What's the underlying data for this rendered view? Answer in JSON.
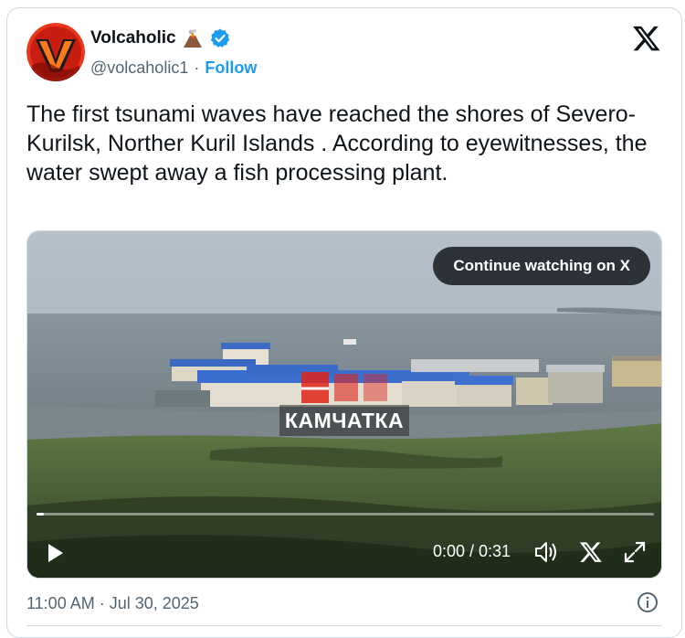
{
  "author": {
    "name": "Volcaholic",
    "name_emoji": "volcano-icon",
    "verified_icon": "verified-badge-icon",
    "handle": "@volcaholic1",
    "separator": "·",
    "follow_label": "Follow",
    "avatar_letter": "V"
  },
  "tweet": {
    "text": "The first tsunami waves have reached the shores of Severo-Kurilsk, Norther Kuril Islands . According to eyewitnesses, the water swept away a fish processing plant."
  },
  "media": {
    "continue_label": "Continue watching on X",
    "watermark": "КАМЧАТКА",
    "time_display": "0:00 / 0:31",
    "progress": 0.01,
    "controls": [
      "play-icon",
      "volume-icon",
      "x-icon",
      "fullscreen-icon"
    ]
  },
  "footer": {
    "timestamp": "11:00 AM · Jul 30, 2025",
    "info_icon": "info-icon"
  },
  "colors": {
    "link": "#1d9bf0",
    "secondary_text": "#536471",
    "border": "#cfd9de"
  }
}
